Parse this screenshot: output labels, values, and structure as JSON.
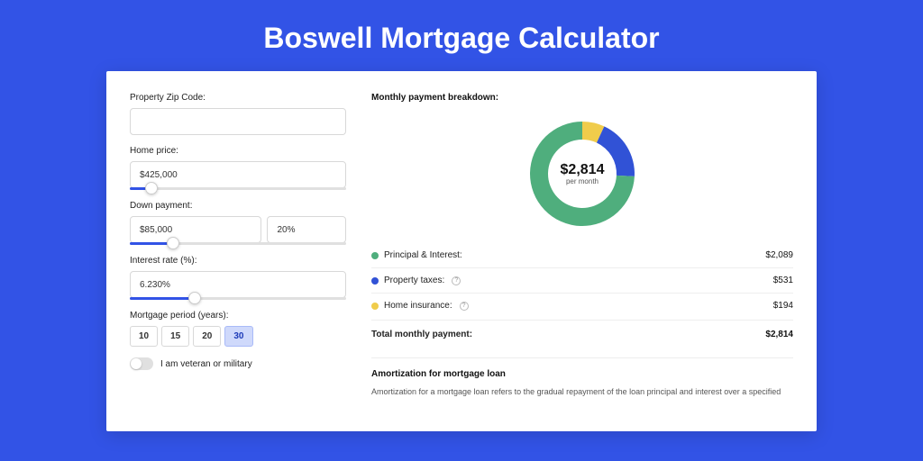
{
  "title": "Boswell Mortgage Calculator",
  "form": {
    "zip_label": "Property Zip Code:",
    "zip_value": "",
    "home_price_label": "Home price:",
    "home_price_value": "$425,000",
    "home_price_slider_pct": 10,
    "down_payment_label": "Down payment:",
    "down_payment_value": "$85,000",
    "down_payment_pct_value": "20%",
    "down_payment_slider_pct": 20,
    "interest_label": "Interest rate (%):",
    "interest_value": "6.230%",
    "interest_slider_pct": 30,
    "period_label": "Mortgage period (years):",
    "periods": [
      "10",
      "15",
      "20",
      "30"
    ],
    "period_selected": "30",
    "veteran_label": "I am veteran or military"
  },
  "breakdown": {
    "title": "Monthly payment breakdown:",
    "center_value": "$2,814",
    "center_label": "per month",
    "items": [
      {
        "label": "Principal & Interest:",
        "value": "$2,089",
        "color": "#4fae7d",
        "help": false,
        "pct": 74.2
      },
      {
        "label": "Property taxes:",
        "value": "$531",
        "color": "#3152d6",
        "help": true,
        "pct": 18.9
      },
      {
        "label": "Home insurance:",
        "value": "$194",
        "color": "#f0cc4b",
        "help": true,
        "pct": 6.9
      }
    ],
    "total_label": "Total monthly payment:",
    "total_value": "$2,814"
  },
  "amort": {
    "title": "Amortization for mortgage loan",
    "text": "Amortization for a mortgage loan refers to the gradual repayment of the loan principal and interest over a specified"
  },
  "chart_data": {
    "type": "pie",
    "title": "Monthly payment breakdown",
    "categories": [
      "Principal & Interest",
      "Property taxes",
      "Home insurance"
    ],
    "values": [
      2089,
      531,
      194
    ],
    "colors": [
      "#4fae7d",
      "#3152d6",
      "#f0cc4b"
    ],
    "total": 2814
  }
}
